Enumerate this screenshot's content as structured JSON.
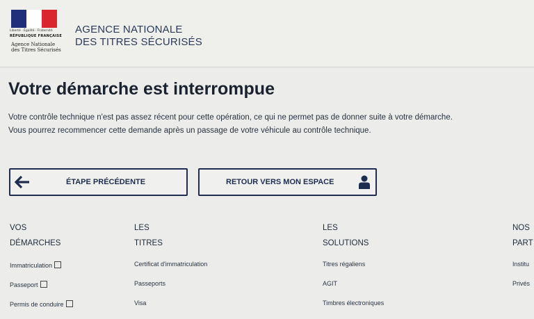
{
  "header": {
    "logo_motto": "Liberté · Égalité · Fraternité",
    "logo_republic": "RÉPUBLIQUE FRANÇAISE",
    "logo_sub": [
      "Agence Nationale",
      "des Titres Sécurisés"
    ],
    "agency_line1": "AGENCE NATIONALE",
    "agency_line2": "DES TITRES SÉCURISÉS"
  },
  "main": {
    "title": "Votre démarche est interrompue",
    "message_line1": "Votre contrôle technique n'est pas assez récent pour cette opération, ce qui ne permet pas de donner suite à votre démarche.",
    "message_line2": "Vous pourrez recommencer cette demande après un passage de votre véhicule au contrôle technique."
  },
  "buttons": {
    "previous": {
      "label": "ÉTAPE PRÉCÉDENTE",
      "icon": "arrow-left-icon"
    },
    "back": {
      "label": "RETOUR VERS MON ESPACE",
      "icon": "user-icon"
    }
  },
  "footer": {
    "columns": [
      {
        "title": [
          "VOS",
          "DÉMARCHES"
        ],
        "links": [
          "Immatriculation",
          "Passeport",
          "Permis de conduire"
        ]
      },
      {
        "title": [
          "LES",
          "TITRES"
        ],
        "links": [
          "Certificat d'immatriculation",
          "Passeports",
          "Visa"
        ]
      },
      {
        "title": [
          "LES",
          "SOLUTIONS"
        ],
        "links": [
          "Titres régaliens",
          "AGIT",
          "Timbres électroniques"
        ]
      },
      {
        "title": [
          "NOS",
          "PART"
        ],
        "links": [
          "Institu",
          "Privés"
        ]
      }
    ]
  },
  "colors": {
    "brand_navy": "#1e2d4f",
    "flag_blue": "#1f2f7a",
    "flag_red": "#d9262f"
  }
}
